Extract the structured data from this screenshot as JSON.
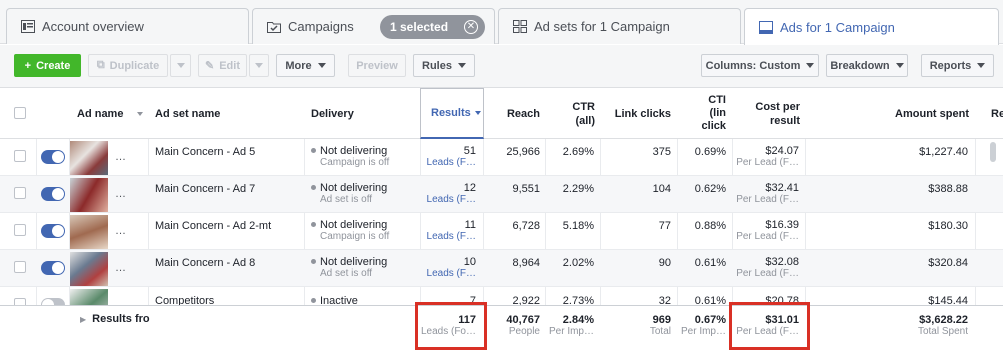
{
  "tabs": {
    "account": "Account overview",
    "campaigns": "Campaigns",
    "selected": "1 selected",
    "adsets": "Ad sets for 1 Campaign",
    "ads": "Ads for 1 Campaign"
  },
  "toolbar": {
    "create": "Create",
    "duplicate": "Duplicate",
    "edit": "Edit",
    "more": "More",
    "preview": "Preview",
    "rules": "Rules",
    "columns": "Columns: Custom",
    "breakdown": "Breakdown",
    "reports": "Reports"
  },
  "headers": {
    "ad_name": "Ad name",
    "ad_set_name": "Ad set name",
    "delivery": "Delivery",
    "results": "Results",
    "reach": "Reach",
    "ctr_all_1": "CTR",
    "ctr_all_2": "(all)",
    "link_clicks": "Link clicks",
    "ctr_link_1": "CTI",
    "ctr_link_2": "(lin",
    "ctr_link_3": "click",
    "cost_1": "Cost per",
    "cost_2": "result",
    "amount_spent": "Amount spent",
    "extra": "Re"
  },
  "rows": [
    {
      "ad_name": "…",
      "ad_set": "Main Concern - Ad 5",
      "delivery": "Not delivering",
      "delivery_sub": "Campaign is off",
      "results": "51",
      "results_sub": "Leads (F…",
      "reach": "25,966",
      "ctr": "2.69%",
      "clicks": "375",
      "ctr_link": "0.69%",
      "cost": "$24.07",
      "cost_sub": "Per Lead (F…",
      "spent": "$1,227.40"
    },
    {
      "ad_name": "…",
      "ad_set": "Main Concern - Ad 7",
      "delivery": "Not delivering",
      "delivery_sub": "Ad set is off",
      "results": "12",
      "results_sub": "Leads (F…",
      "reach": "9,551",
      "ctr": "2.29%",
      "clicks": "104",
      "ctr_link": "0.62%",
      "cost": "$32.41",
      "cost_sub": "Per Lead (F…",
      "spent": "$388.88"
    },
    {
      "ad_name": "…",
      "ad_set": "Main Concern - Ad 2-mt",
      "delivery": "Not delivering",
      "delivery_sub": "Campaign is off",
      "results": "11",
      "results_sub": "Leads (F…",
      "reach": "6,728",
      "ctr": "5.18%",
      "clicks": "77",
      "ctr_link": "0.88%",
      "cost": "$16.39",
      "cost_sub": "Per Lead (F…",
      "spent": "$180.30"
    },
    {
      "ad_name": "…",
      "ad_set": "Main Concern - Ad 8",
      "delivery": "Not delivering",
      "delivery_sub": "Ad set is off",
      "results": "10",
      "results_sub": "Leads (F…",
      "reach": "8,964",
      "ctr": "2.02%",
      "clicks": "90",
      "ctr_link": "0.61%",
      "cost": "$32.08",
      "cost_sub": "Per Lead (F…",
      "spent": "$320.84"
    },
    {
      "ad_name": "",
      "ad_set": "Competitors",
      "delivery": "Inactive",
      "delivery_sub": "",
      "results": "7",
      "results_sub": "",
      "reach": "2,922",
      "ctr": "2.73%",
      "clicks": "32",
      "ctr_link": "0.61%",
      "cost": "$20.78",
      "cost_sub": "",
      "spent": "$145.44"
    }
  ],
  "footer": {
    "label": "Results fro",
    "results": "117",
    "results_sub": "Leads (Fo…",
    "reach": "40,767",
    "reach_sub": "People",
    "ctr": "2.84%",
    "ctr_sub": "Per Imp…",
    "clicks": "969",
    "clicks_sub": "Total",
    "ctr_link": "0.67%",
    "ctr_link_sub": "Per Imp…",
    "cost": "$31.01",
    "cost_sub": "Per Lead (F…",
    "spent": "$3,628.22",
    "spent_sub": "Total Spent"
  },
  "colors": {
    "accent": "#4267b2",
    "create_green": "#42b72a",
    "highlight_red": "#d93025"
  }
}
